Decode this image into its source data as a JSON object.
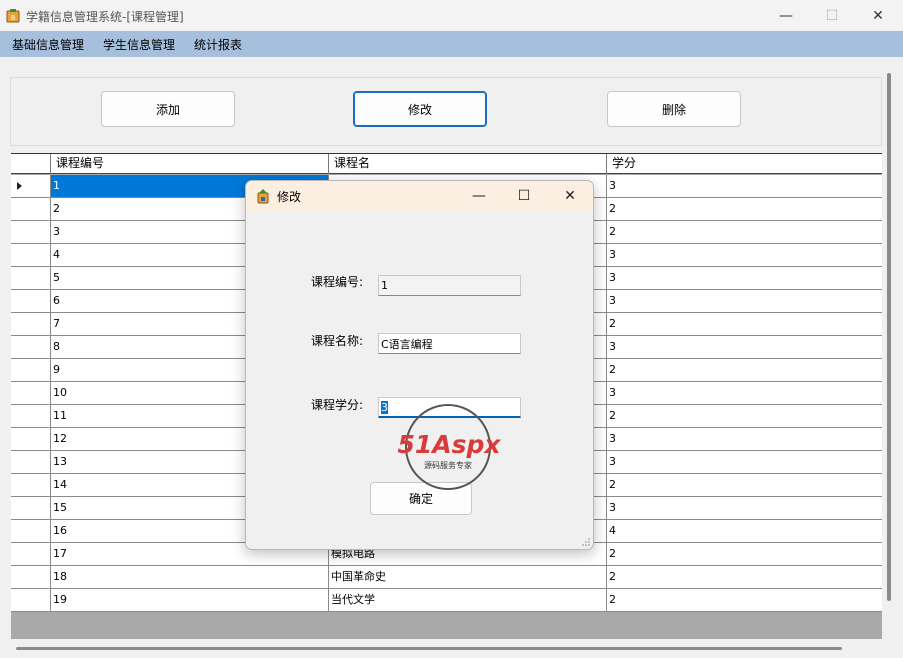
{
  "window": {
    "title": "学籍信息管理系统-[课程管理]",
    "minimize_glyph": "—",
    "maximize_glyph": "☐",
    "close_glyph": "✕"
  },
  "menu": {
    "items": [
      {
        "label": "基础信息管理"
      },
      {
        "label": "学生信息管理"
      },
      {
        "label": "统计报表"
      }
    ]
  },
  "toolbar": {
    "add_label": "添加",
    "edit_label": "修改",
    "delete_label": "删除"
  },
  "grid": {
    "columns": [
      "课程编号",
      "课程名",
      "学分"
    ],
    "rows": [
      {
        "id": "1",
        "name": "",
        "credit": "3"
      },
      {
        "id": "2",
        "name": "",
        "credit": "2"
      },
      {
        "id": "3",
        "name": "",
        "credit": "2"
      },
      {
        "id": "4",
        "name": "",
        "credit": "3"
      },
      {
        "id": "5",
        "name": "",
        "credit": "3"
      },
      {
        "id": "6",
        "name": "",
        "credit": "3"
      },
      {
        "id": "7",
        "name": "",
        "credit": "2"
      },
      {
        "id": "8",
        "name": "",
        "credit": "3"
      },
      {
        "id": "9",
        "name": "",
        "credit": "2"
      },
      {
        "id": "10",
        "name": "",
        "credit": "3"
      },
      {
        "id": "11",
        "name": "",
        "credit": "2"
      },
      {
        "id": "12",
        "name": "",
        "credit": "3"
      },
      {
        "id": "13",
        "name": "",
        "credit": "3"
      },
      {
        "id": "14",
        "name": "",
        "credit": "2"
      },
      {
        "id": "15",
        "name": "",
        "credit": "3"
      },
      {
        "id": "16",
        "name": "",
        "credit": "4"
      },
      {
        "id": "17",
        "name": "模拟电路",
        "credit": "2"
      },
      {
        "id": "18",
        "name": "中国革命史",
        "credit": "2"
      },
      {
        "id": "19",
        "name": "当代文学",
        "credit": "2"
      }
    ]
  },
  "dialog": {
    "title": "修改",
    "minimize_glyph": "—",
    "maximize_glyph": "☐",
    "close_glyph": "✕",
    "fields": {
      "id_label": "课程编号:",
      "id_value": "1",
      "name_label": "课程名称:",
      "name_value": "C语言编程",
      "credit_label": "课程学分:",
      "credit_value": "3"
    },
    "ok_label": "确定"
  },
  "watermark": {
    "brand": "51Aspx",
    "tagline": "源码服务专家"
  },
  "colors": {
    "menubar": "#a5bfdc",
    "selection": "#0078d7",
    "dialog_titlebar": "#fbefe2"
  }
}
